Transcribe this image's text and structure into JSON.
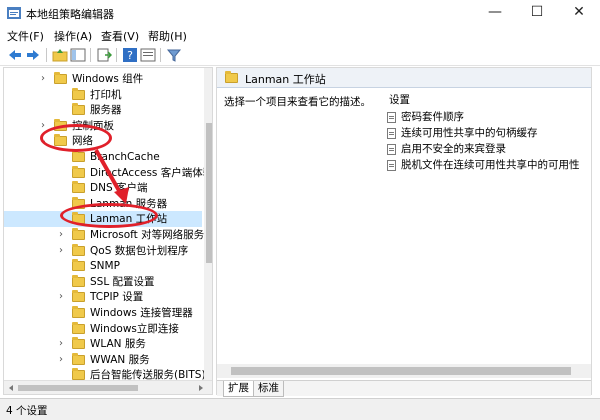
{
  "window": {
    "title": "本地组策略编辑器",
    "minimize": "—",
    "maximize": "☐",
    "close": "✕"
  },
  "menu": [
    "文件(F)",
    "操作(A)",
    "查看(V)",
    "帮助(H)"
  ],
  "toolbar_icons": [
    "back-icon",
    "forward-icon",
    "up-folder-icon",
    "show-hide-tree-icon",
    "export-list-icon",
    "help-icon",
    "properties-icon",
    "filter-icon"
  ],
  "tree": [
    {
      "label": "Windows 组件",
      "chevron": "›"
    },
    {
      "label": "打印机",
      "chevron": ""
    },
    {
      "label": "服务器",
      "chevron": ""
    },
    {
      "label": "控制面板",
      "chevron": "›"
    },
    {
      "label": "网络",
      "chevron": "⌄"
    },
    {
      "label": "BranchCache",
      "chevron": ""
    },
    {
      "label": "DirectAccess 客户端体验设",
      "chevron": ""
    },
    {
      "label": "DNS 客户端",
      "chevron": ""
    },
    {
      "label": "Lanman 服务器",
      "chevron": ""
    },
    {
      "label": "Lanman 工作站",
      "chevron": ""
    },
    {
      "label": "Microsoft 对等网络服务",
      "chevron": "›"
    },
    {
      "label": "QoS 数据包计划程序",
      "chevron": "›"
    },
    {
      "label": "SNMP",
      "chevron": ""
    },
    {
      "label": "SSL 配置设置",
      "chevron": ""
    },
    {
      "label": "TCPIP 设置",
      "chevron": "›"
    },
    {
      "label": "Windows 连接管理器",
      "chevron": ""
    },
    {
      "label": "Windows立即连接",
      "chevron": ""
    },
    {
      "label": "WLAN 服务",
      "chevron": "›"
    },
    {
      "label": "WWAN 服务",
      "chevron": "›"
    },
    {
      "label": "后台智能传送服务(BITS)",
      "chevron": ""
    }
  ],
  "right": {
    "header": "Lanman 工作站",
    "description": "选择一个项目来查看它的描述。",
    "settings_label": "设置",
    "settings": [
      "密码套件顺序",
      "连续可用性共享中的句柄缓存",
      "启用不安全的来宾登录",
      "脱机文件在连续可用性共享中的可用性"
    ]
  },
  "tabs": [
    "扩展",
    "标准"
  ],
  "status": "4 个设置",
  "colors": {
    "annotation": "#e0202a",
    "selection": "#cce8ff",
    "folder": "#f0c94a"
  }
}
